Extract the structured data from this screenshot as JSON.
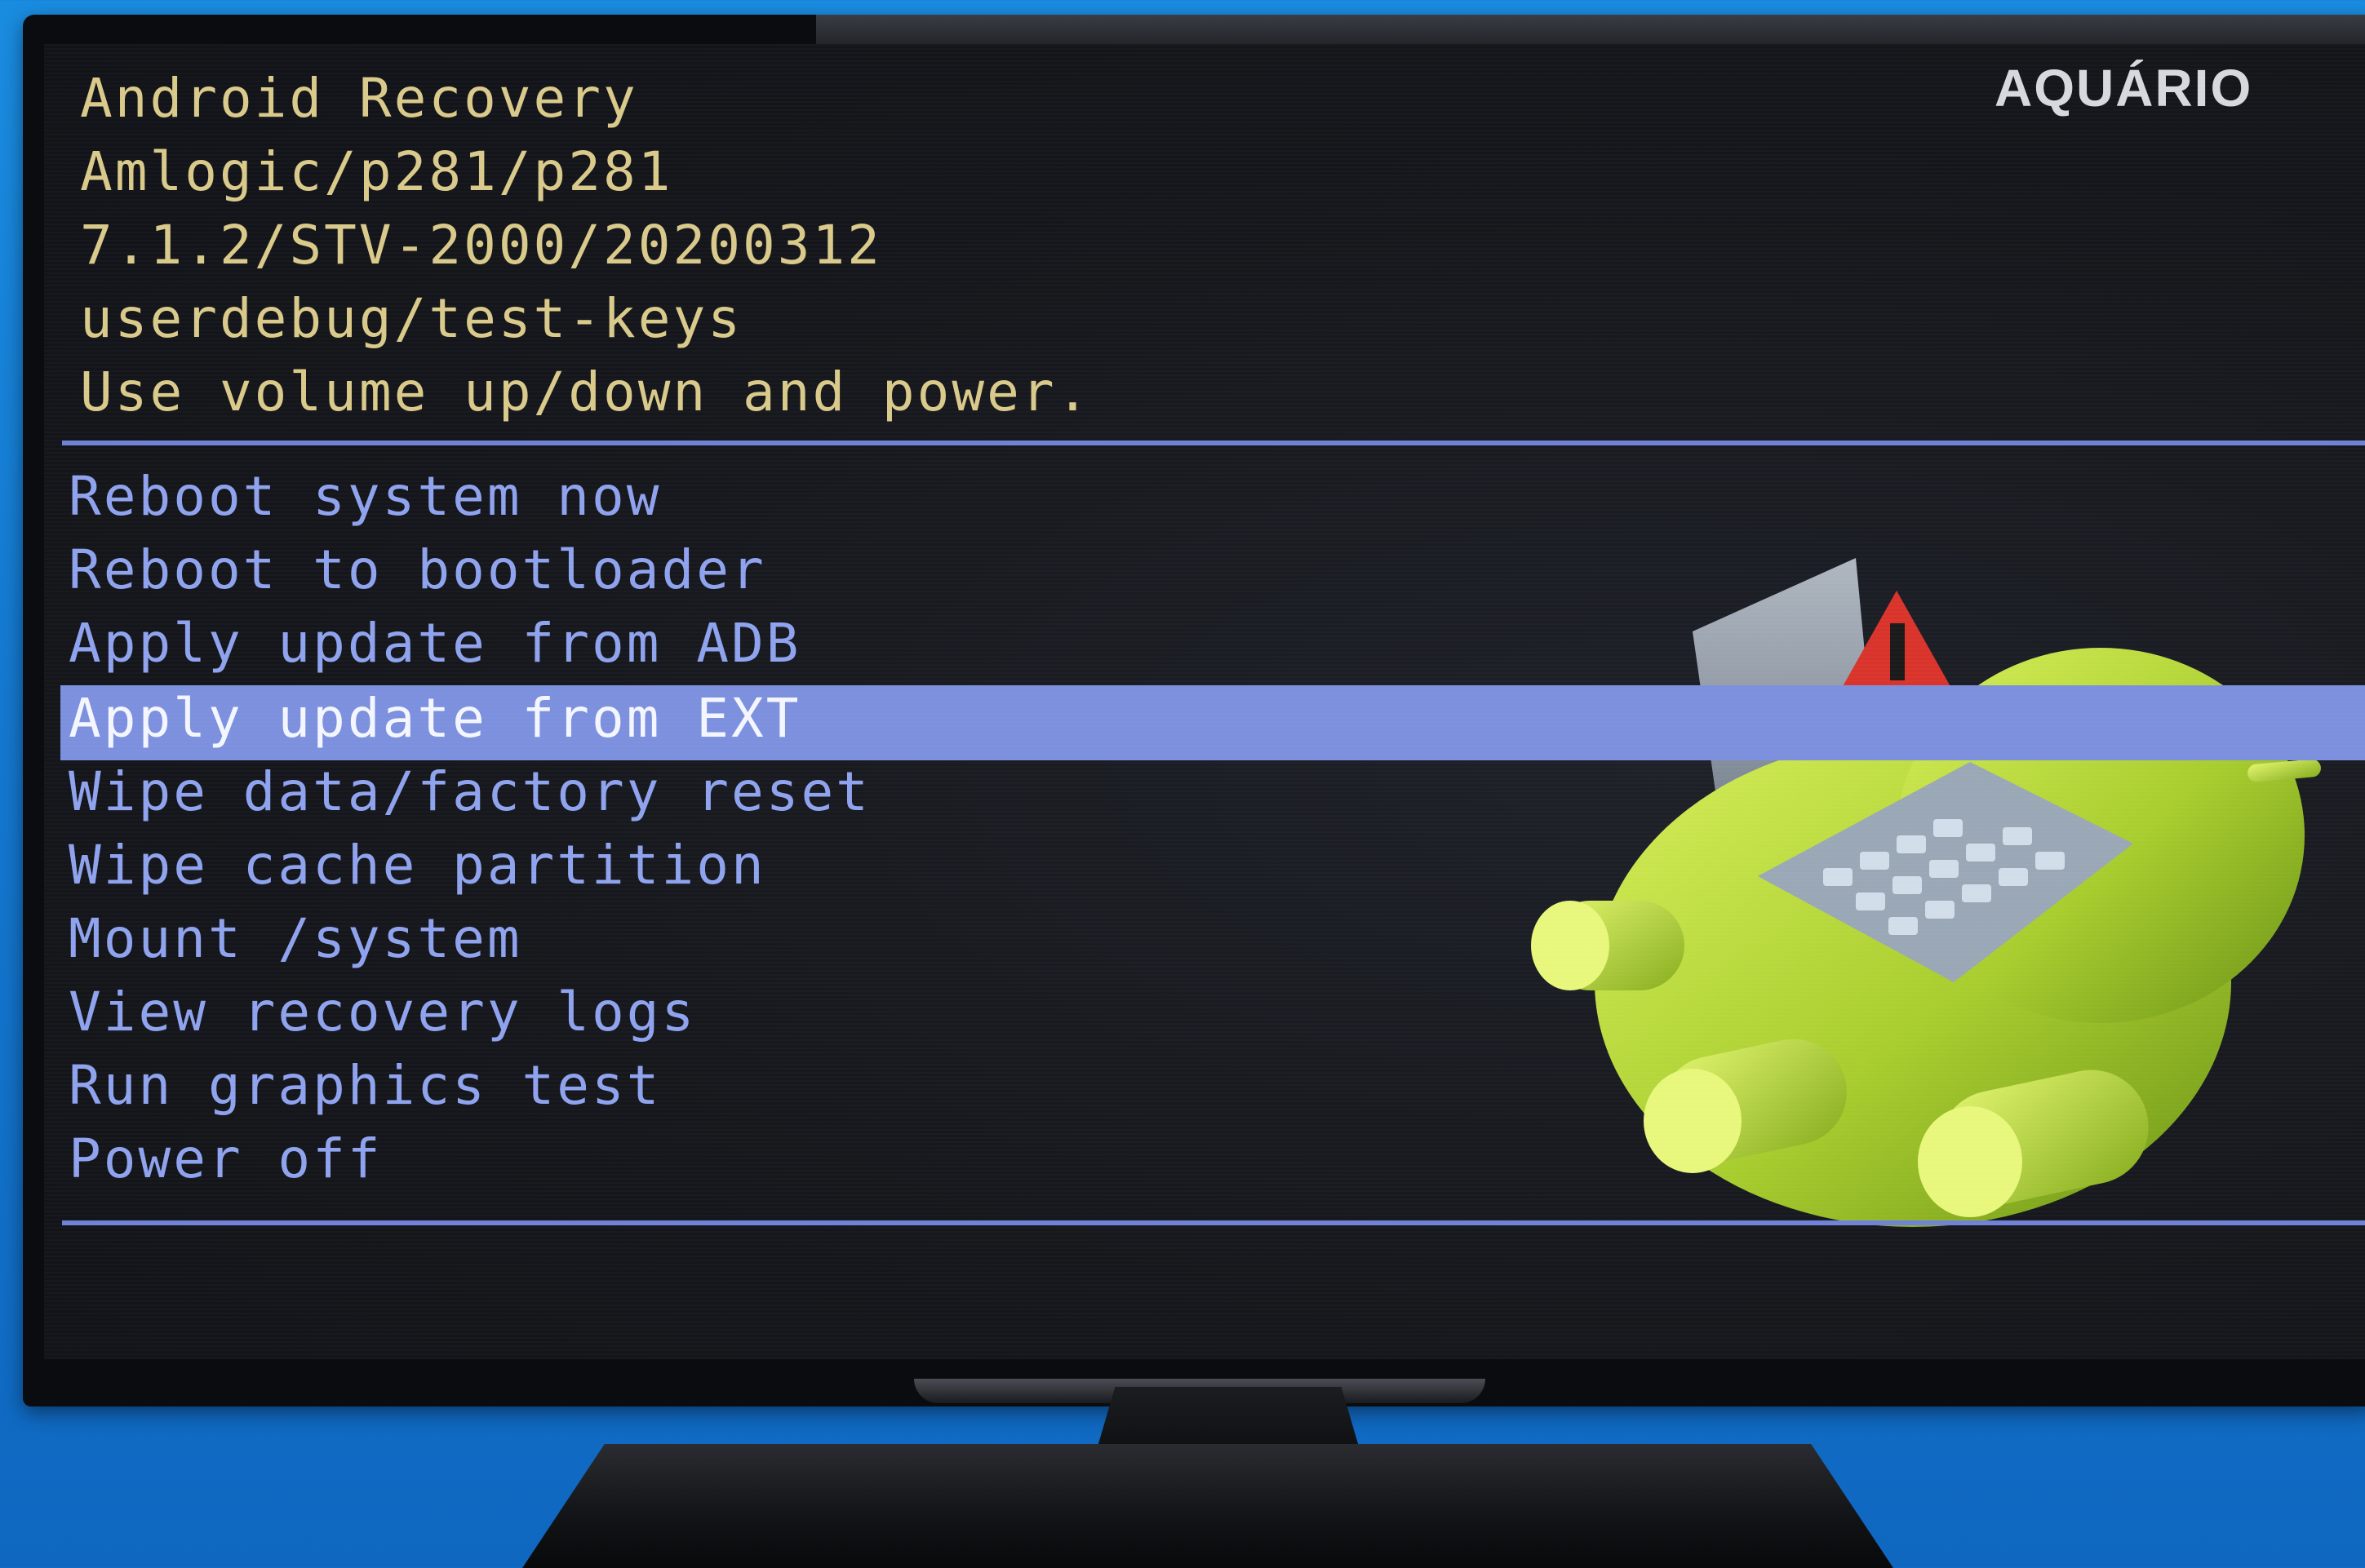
{
  "brand": {
    "logo_text": "AQUÁRIO"
  },
  "recovery": {
    "header_lines": [
      "Android Recovery",
      "Amlogic/p281/p281",
      "7.1.2/STV-2000/20200312",
      "userdebug/test-keys",
      "Use volume up/down and power."
    ],
    "menu_items": [
      "Reboot system now",
      "Reboot to bootloader",
      "Apply update from ADB",
      "Apply update from EXT",
      "Wipe data/factory reset",
      "Wipe cache partition",
      "Mount /system",
      "View recovery logs",
      "Run graphics test",
      "Power off"
    ],
    "selected_item": "Apply update from EXT"
  },
  "colors": {
    "header_text": "#d9c98a",
    "menu_text": "#8fa2ee",
    "highlight": "#7c90de",
    "divider": "#6f82d8",
    "background_wall": "#1478cf"
  },
  "icons": {
    "android_error": "android-robot-error-icon",
    "warning": "warning-triangle-icon"
  }
}
